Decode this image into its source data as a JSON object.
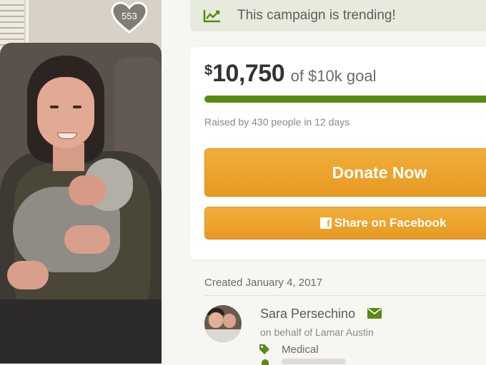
{
  "photo": {
    "heart_icon": "heart-outline-icon",
    "heart_count": "553"
  },
  "trending": {
    "icon": "trend-chart-icon",
    "text": "This campaign is trending!"
  },
  "progress": {
    "currency_symbol": "$",
    "amount_raised": "10,750",
    "goal_text": "of $10k goal",
    "fraction": 1.0,
    "meta": "Raised by 430 people in 12 days"
  },
  "buttons": {
    "donate_label": "Donate Now",
    "share_label": "Share on Facebook",
    "share_icon": "facebook-icon"
  },
  "details": {
    "created": "Created January 4, 2017",
    "organizer_name": "Sara Persechino",
    "organizer_behalf": "on behalf of Lamar Austin",
    "category": "Medical"
  },
  "colors": {
    "accent_green": "#5a8a13",
    "button_orange": "#ea9f29",
    "trending_bg": "#e6ebdd"
  }
}
